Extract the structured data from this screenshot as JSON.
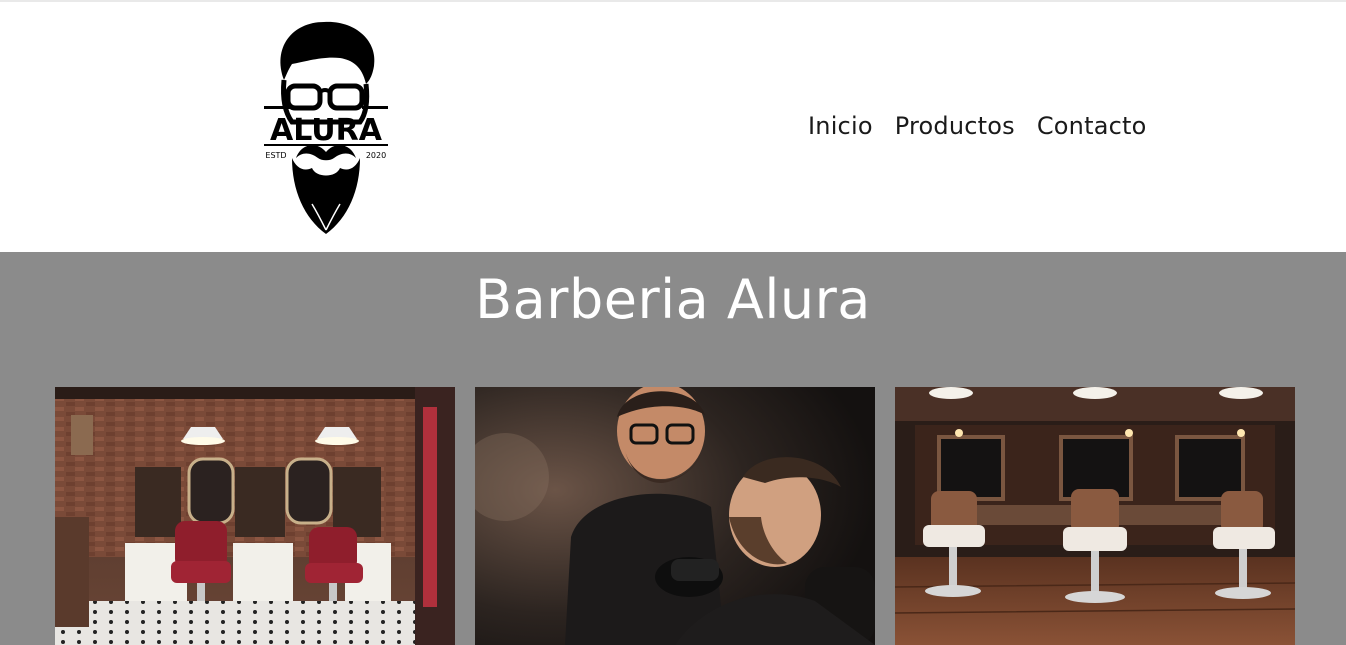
{
  "logo": {
    "wordmark": "ALURA",
    "estd_label": "ESTD",
    "year_label": "2020"
  },
  "nav": {
    "items": [
      {
        "label": "Inicio"
      },
      {
        "label": "Productos"
      },
      {
        "label": "Contacto"
      }
    ]
  },
  "hero": {
    "title": "Barberia Alura"
  },
  "gallery": [
    {
      "icon": "barbershop-interior-photo"
    },
    {
      "icon": "barber-trimming-beard-photo"
    },
    {
      "icon": "barbershop-chairs-photo"
    }
  ],
  "colors": {
    "hero_background": "#8b8b8b",
    "nav_text": "#1a1a1a",
    "title_text": "#ffffff"
  }
}
